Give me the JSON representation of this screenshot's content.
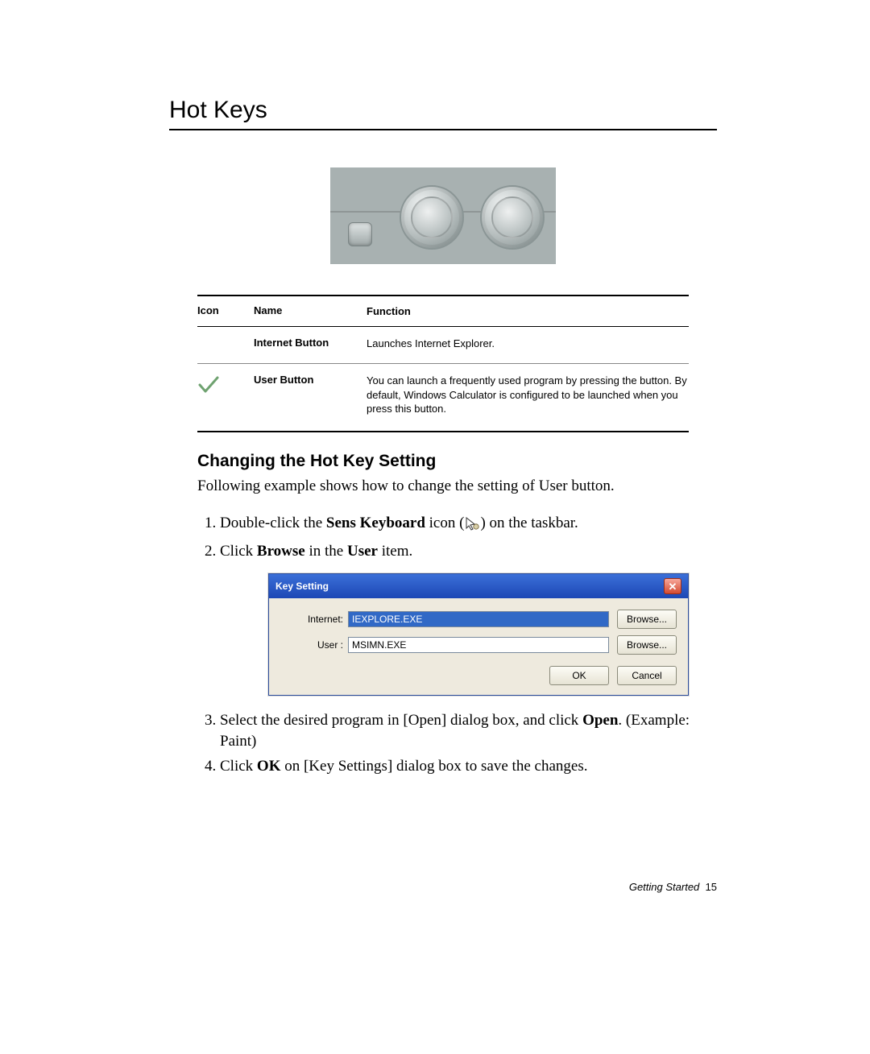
{
  "title": "Hot Keys",
  "table": {
    "headers": {
      "icon": "Icon",
      "name": "Name",
      "func": "Function"
    },
    "rows": [
      {
        "name": "Internet Button",
        "func": "Launches Internet Explorer."
      },
      {
        "name": "User Button",
        "func": "You can launch a frequently used program by pressing the button. By default, Windows Calculator is configured to be launched when you press this button."
      }
    ]
  },
  "subheading": "Changing the Hot Key Setting",
  "lead": "Following example shows how to change the setting of User button.",
  "steps": {
    "s1a": "Double-click the ",
    "s1b": "Sens Keyboard",
    "s1c": " icon (",
    "s1d": ") on the taskbar.",
    "s2a": "Click ",
    "s2b": "Browse",
    "s2c": " in the ",
    "s2d": "User",
    "s2e": " item.",
    "s3a": "Select the desired program in [Open] dialog box, and click ",
    "s3b": "Open",
    "s3c": ". (Example: Paint)",
    "s4a": "Click ",
    "s4b": "OK",
    "s4c": " on [Key Settings] dialog box to save the changes."
  },
  "dialog": {
    "title": "Key Setting",
    "internet_label": "Internet:",
    "internet_value": "IEXPLORE.EXE",
    "user_label": "User :",
    "user_value": "MSIMN.EXE",
    "browse": "Browse...",
    "ok": "OK",
    "cancel": "Cancel"
  },
  "footer": {
    "section": "Getting Started",
    "page": "15"
  }
}
